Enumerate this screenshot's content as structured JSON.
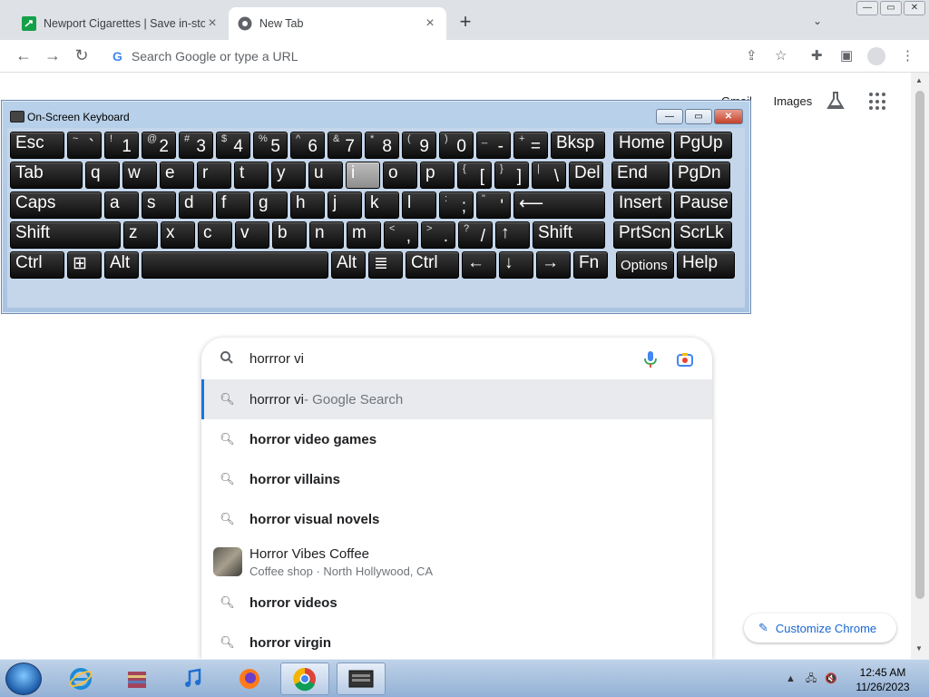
{
  "browser": {
    "tabs": [
      {
        "title": "Newport Cigarettes | Save in-stor",
        "active": false
      },
      {
        "title": "New Tab",
        "active": true
      }
    ],
    "new_tab_symbol": "+",
    "omnibox_placeholder": "Search Google or type a URL"
  },
  "page": {
    "top_links": [
      "Gmail",
      "Images"
    ],
    "search": {
      "query": "horrror vi",
      "suggestions": [
        {
          "bold": "horrror vi",
          "rest": " - Google Search",
          "selected": true
        },
        {
          "bold": "horror video games",
          "rest": "",
          "selected": false
        },
        {
          "bold": "horror villains",
          "rest": "",
          "selected": false
        },
        {
          "bold": "horror visual novels",
          "rest": "",
          "selected": false
        }
      ],
      "entity": {
        "name": "Horror Vibes Coffee",
        "detail": "Coffee shop · North Hollywood, CA"
      },
      "more_suggestions": [
        {
          "bold": "horror videos"
        },
        {
          "bold": "horror virgin"
        }
      ]
    },
    "customize_label": "Customize Chrome"
  },
  "osk": {
    "title": "On-Screen Keyboard",
    "rows": [
      [
        {
          "main": "Esc",
          "w": 60
        },
        {
          "shift": "~",
          "main": "`",
          "w": 38
        },
        {
          "shift": "!",
          "main": "1",
          "w": 38
        },
        {
          "shift": "@",
          "main": "2",
          "w": 38
        },
        {
          "shift": "#",
          "main": "3",
          "w": 38
        },
        {
          "shift": "$",
          "main": "4",
          "w": 38
        },
        {
          "shift": "%",
          "main": "5",
          "w": 38
        },
        {
          "shift": "^",
          "main": "6",
          "w": 38
        },
        {
          "shift": "&",
          "main": "7",
          "w": 38
        },
        {
          "shift": "*",
          "main": "8",
          "w": 38
        },
        {
          "shift": "(",
          "main": "9",
          "w": 38
        },
        {
          "shift": ")",
          "main": "0",
          "w": 38
        },
        {
          "shift": "_",
          "main": "-",
          "w": 38
        },
        {
          "shift": "+",
          "main": "=",
          "w": 38
        },
        {
          "main": "Bksp",
          "w": 60
        },
        {
          "gap": 6
        },
        {
          "main": "Home",
          "w": 64
        },
        {
          "main": "PgUp",
          "w": 64
        }
      ],
      [
        {
          "main": "Tab",
          "w": 80
        },
        {
          "main": "q",
          "w": 38
        },
        {
          "main": "w",
          "w": 38
        },
        {
          "main": "e",
          "w": 38
        },
        {
          "main": "r",
          "w": 38
        },
        {
          "main": "t",
          "w": 38
        },
        {
          "main": "y",
          "w": 38
        },
        {
          "main": "u",
          "w": 38
        },
        {
          "main": "i",
          "w": 38,
          "hl": true
        },
        {
          "main": "o",
          "w": 38
        },
        {
          "main": "p",
          "w": 38
        },
        {
          "shift": "{",
          "main": "[",
          "w": 38
        },
        {
          "shift": "}",
          "main": "]",
          "w": 38
        },
        {
          "shift": "|",
          "main": "\\",
          "w": 38
        },
        {
          "main": "Del",
          "w": 38
        },
        {
          "gap": 6
        },
        {
          "main": "End",
          "w": 64
        },
        {
          "main": "PgDn",
          "w": 64
        }
      ],
      [
        {
          "main": "Caps",
          "w": 101
        },
        {
          "main": "a",
          "w": 38
        },
        {
          "main": "s",
          "w": 38
        },
        {
          "main": "d",
          "w": 38
        },
        {
          "main": "f",
          "w": 38
        },
        {
          "main": "g",
          "w": 38
        },
        {
          "main": "h",
          "w": 38
        },
        {
          "main": "j",
          "w": 38
        },
        {
          "main": "k",
          "w": 38
        },
        {
          "main": "l",
          "w": 38
        },
        {
          "shift": ":",
          "main": ";",
          "w": 38
        },
        {
          "shift": "\"",
          "main": "'",
          "w": 38
        },
        {
          "main": "⟵",
          "w": 101
        },
        {
          "gap": 6
        },
        {
          "main": "Insert",
          "w": 64
        },
        {
          "main": "Pause",
          "w": 64
        }
      ],
      [
        {
          "main": "Shift",
          "w": 122
        },
        {
          "main": "z",
          "w": 38
        },
        {
          "main": "x",
          "w": 38
        },
        {
          "main": "c",
          "w": 38
        },
        {
          "main": "v",
          "w": 38
        },
        {
          "main": "b",
          "w": 38
        },
        {
          "main": "n",
          "w": 38
        },
        {
          "main": "m",
          "w": 38
        },
        {
          "shift": "<",
          "main": ",",
          "w": 38
        },
        {
          "shift": ">",
          "main": ".",
          "w": 38
        },
        {
          "shift": "?",
          "main": "/",
          "w": 38
        },
        {
          "main": "↑",
          "w": 38
        },
        {
          "main": "Shift",
          "w": 80
        },
        {
          "gap": 6
        },
        {
          "main": "PrtScn",
          "w": 64
        },
        {
          "main": "ScrLk",
          "w": 64
        }
      ],
      [
        {
          "main": "Ctrl",
          "w": 60
        },
        {
          "main": "⊞",
          "w": 38
        },
        {
          "main": "Alt",
          "w": 38
        },
        {
          "main": "",
          "w": 206
        },
        {
          "main": "Alt",
          "w": 38
        },
        {
          "main": "≣",
          "w": 38
        },
        {
          "main": "Ctrl",
          "w": 59
        },
        {
          "main": "←",
          "w": 38
        },
        {
          "main": "↓",
          "w": 38
        },
        {
          "main": "→",
          "w": 38
        },
        {
          "main": "Fn",
          "w": 38
        },
        {
          "gap": 6
        },
        {
          "main": "Options",
          "w": 64,
          "small": true
        },
        {
          "main": "Help",
          "w": 64
        }
      ]
    ]
  },
  "taskbar": {
    "apps": [
      "start",
      "internet-explorer",
      "file-archive",
      "music",
      "firefox",
      "chrome",
      "on-screen-keyboard"
    ],
    "time": "12:45 AM",
    "date": "11/26/2023"
  }
}
